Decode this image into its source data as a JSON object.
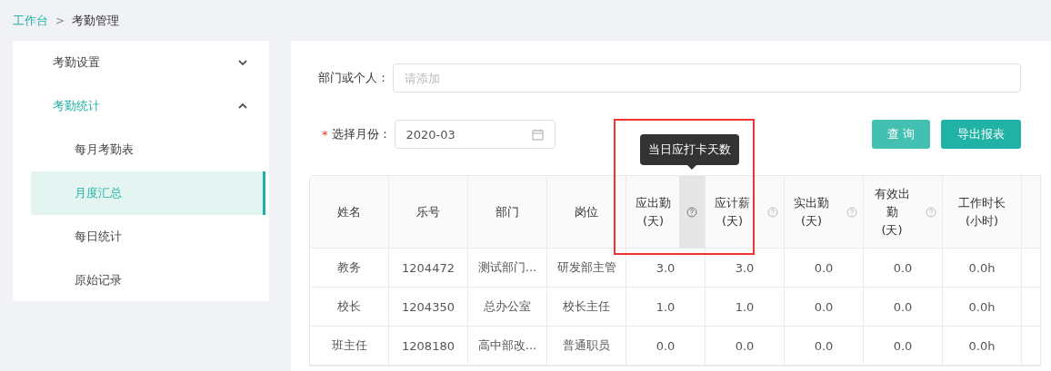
{
  "breadcrumb": [
    {
      "label": "工作台",
      "link": true
    },
    {
      "label": "考勤管理",
      "link": false
    }
  ],
  "breadcrumb_separator": ">",
  "sidebar": {
    "items": [
      {
        "label": "考勤设置",
        "expanded": false,
        "selected": false
      },
      {
        "label": "考勤统计",
        "expanded": true,
        "selected": true,
        "children": [
          {
            "label": "每月考勤表",
            "selected": false
          },
          {
            "label": "月度汇总",
            "selected": true
          },
          {
            "label": "每日统计",
            "selected": false
          },
          {
            "label": "原始记录",
            "selected": false
          }
        ]
      }
    ]
  },
  "filters": {
    "person": {
      "label": "部门或个人：",
      "placeholder": "请添加"
    },
    "month": {
      "required_mark": "*",
      "label": "选择月份：",
      "value": "2020-03"
    }
  },
  "buttons": [
    {
      "label": "查 询",
      "kind": "query"
    },
    {
      "label": "导出报表",
      "kind": "export"
    }
  ],
  "table": {
    "columns": [
      {
        "label": "姓名",
        "kind": "plain"
      },
      {
        "label": "乐号",
        "kind": "plain"
      },
      {
        "label": "部门",
        "kind": "plain"
      },
      {
        "label": "岗位",
        "kind": "plain"
      },
      {
        "label": "应出勤\n(天)",
        "kind": "help",
        "hovered": true
      },
      {
        "label": "应计薪\n(天)",
        "kind": "help",
        "hovered": false
      },
      {
        "label": "实出勤\n(天)",
        "kind": "help",
        "hovered": false
      },
      {
        "label": "有效出勤\n(天)",
        "kind": "help",
        "hovered": false
      },
      {
        "label": "工作时长\n(小时)",
        "kind": "plain"
      }
    ],
    "rows": [
      [
        "教务",
        "1204472",
        "测试部门...",
        "研发部主管",
        "3.0",
        "3.0",
        "0.0",
        "0.0",
        "0.0h"
      ],
      [
        "校长",
        "1204350",
        "总办公室",
        "校长主任",
        "1.0",
        "1.0",
        "0.0",
        "0.0",
        "0.0h"
      ],
      [
        "班主任",
        "1208180",
        "高中部改...",
        "普通职员",
        "0.0",
        "0.0",
        "0.0",
        "0.0",
        "0.0h"
      ]
    ]
  },
  "tooltip": {
    "text": "当日应打卡天数"
  }
}
